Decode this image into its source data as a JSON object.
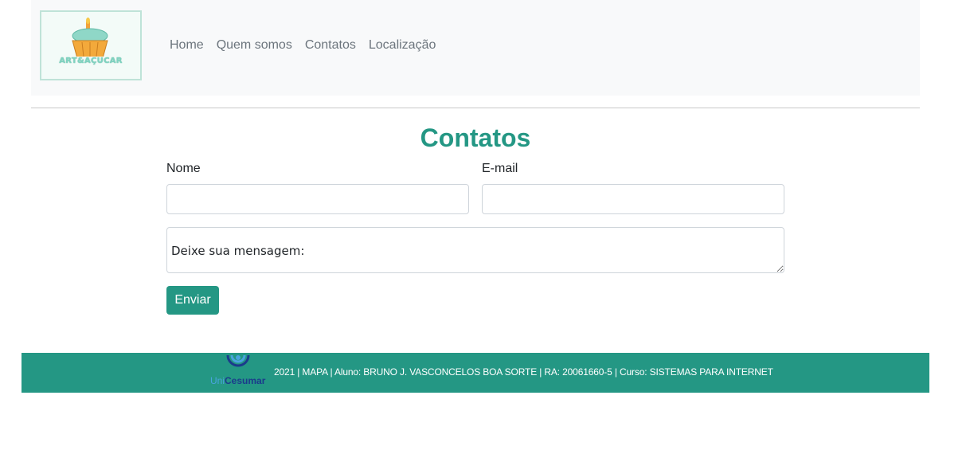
{
  "brand": {
    "logo_text": "ART&AÇUCAR",
    "footer_logo_uni": "Uni",
    "footer_logo_cesumar": "Cesumar"
  },
  "nav": {
    "links": [
      "Home",
      "Quem somos",
      "Contatos",
      "Localização"
    ]
  },
  "main": {
    "title": "Contatos",
    "form": {
      "name_label": "Nome",
      "name_value": "",
      "email_label": "E-mail",
      "email_value": "",
      "message_placeholder": "Deixe sua mensagem:",
      "submit_label": "Enviar"
    }
  },
  "footer": {
    "text": "2021 | MAPA | Aluno: BRUNO J. VASCONCELOS BOA SORTE | RA: 20061660-5 | Curso: SISTEMAS PARA INTERNET"
  },
  "colors": {
    "accent": "#249784",
    "navbar_bg": "#f8f9fa",
    "nav_link": "#6c757d"
  }
}
